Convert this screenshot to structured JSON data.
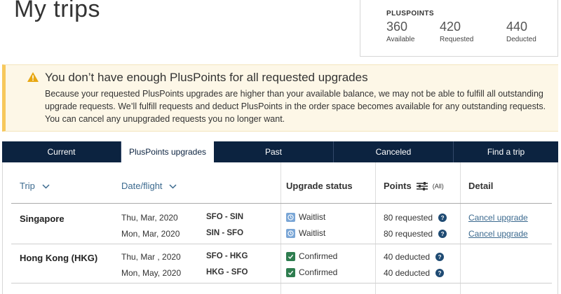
{
  "page": {
    "title": "My trips"
  },
  "pluspoints": {
    "heading": "PLUSPOINTS",
    "available": {
      "value": "360",
      "label": "Available"
    },
    "requested": {
      "value": "420",
      "label": "Requested"
    },
    "deducted": {
      "value": "440",
      "label": "Deducted"
    }
  },
  "alert": {
    "icon": "warning-icon",
    "title": "You don’t have enough PlusPoints for all requested upgrades",
    "body": "Because your requested PlusPoints upgrades are higher than your available balance, we may not be able to fulfill all outstanding upgrade requests. We’ll fulfill requests and deduct PlusPoints in the order space becomes available for any outstanding requests. You can cancel any unupgraded requests you no longer want."
  },
  "tabs": [
    {
      "label": "Current",
      "active": false
    },
    {
      "label": "PlusPoints upgrades",
      "active": true
    },
    {
      "label": "Past",
      "active": false
    },
    {
      "label": "Canceled",
      "active": false
    },
    {
      "label": "Find a trip",
      "active": false
    }
  ],
  "table": {
    "headers": {
      "trip": "Trip",
      "date_flight": "Date/flight",
      "upgrade_status": "Upgrade status",
      "points": "Points",
      "points_filter": "(All)",
      "detail": "Detail"
    },
    "trips": [
      {
        "name": "Singapore",
        "segments": [
          {
            "date": "Thu, Mar, 2020",
            "route": "SFO - SIN",
            "status": "Waitlist",
            "status_icon": "clock-icon",
            "points": "80 requested",
            "detail": "Cancel upgrade"
          },
          {
            "date": "Mon, Mar, 2020",
            "route": "SIN - SFO",
            "status": "Waitlist",
            "status_icon": "clock-icon",
            "points": "80 requested",
            "detail": "Cancel upgrade"
          }
        ]
      },
      {
        "name": "Hong Kong (HKG)",
        "segments": [
          {
            "date": "Thu, Mar ,  2020",
            "route": "SFO - HKG",
            "status": "Confirmed",
            "status_icon": "check-icon",
            "points": "40 deducted",
            "detail": ""
          },
          {
            "date": "Mon, May, 2020",
            "route": "HKG - SFO",
            "status": "Confirmed",
            "status_icon": "check-icon",
            "points": "40 deducted",
            "detail": ""
          }
        ]
      }
    ]
  },
  "colors": {
    "navy": "#0c2340",
    "link": "#3c6a8f",
    "alert_bg": "#fdf7e7",
    "alert_border": "#f7c85c",
    "waitlist": "#7aa6d6",
    "confirmed": "#2e7d4f"
  }
}
